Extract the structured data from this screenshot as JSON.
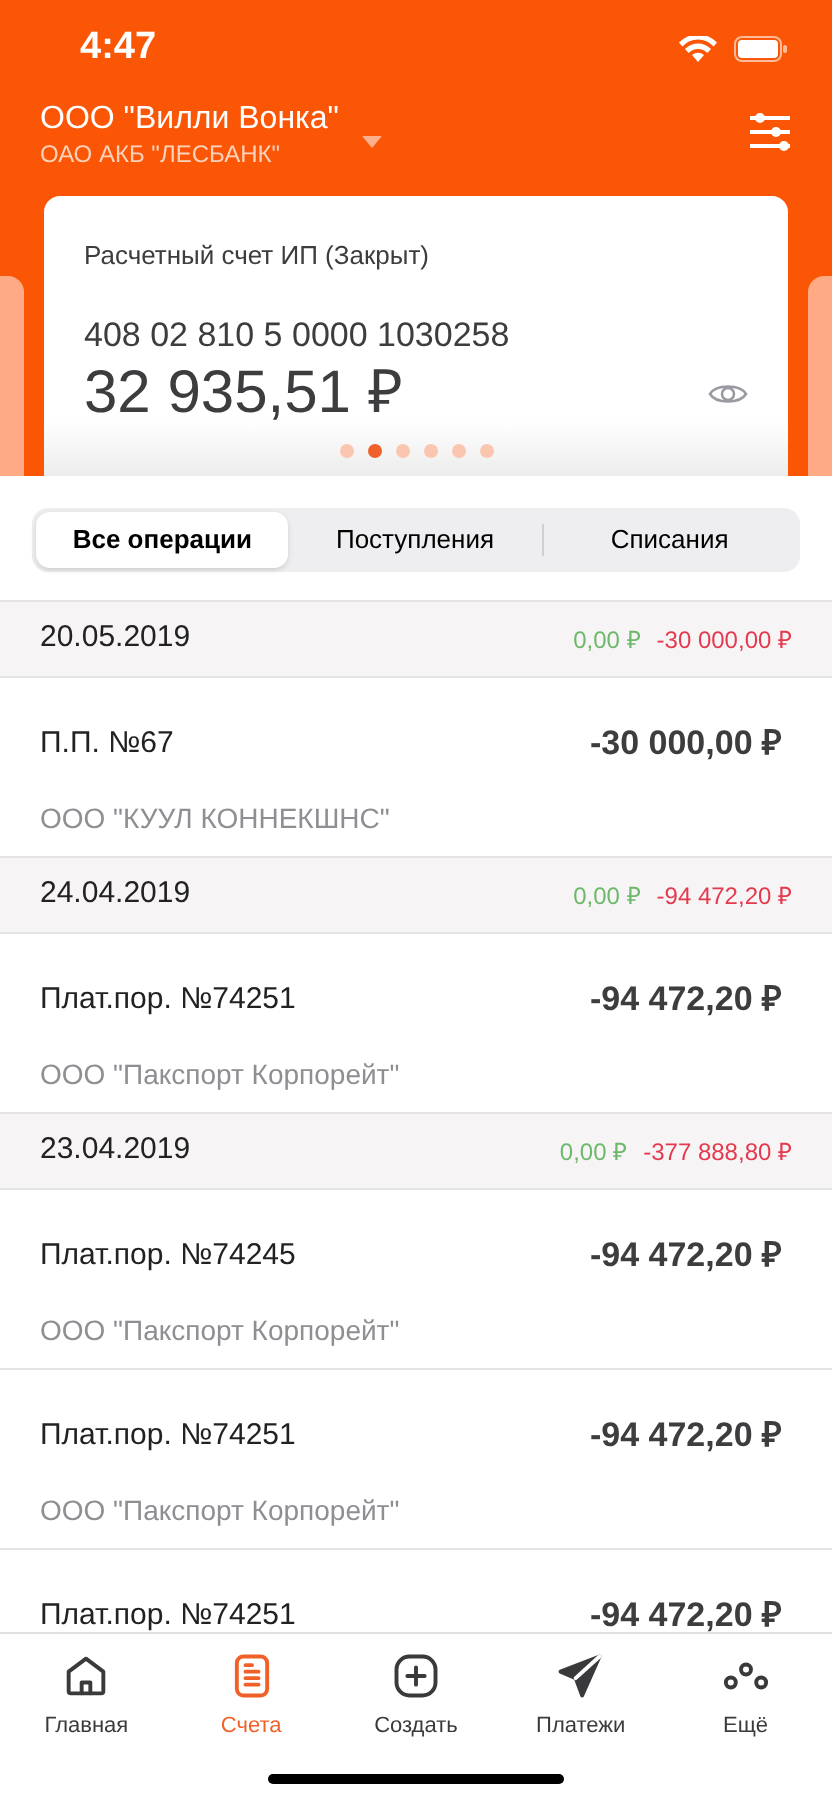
{
  "status_bar": {
    "time": "4:47"
  },
  "header": {
    "company": "ООО \"Вилли Вонка\"",
    "bank": "ОАО АКБ \"ЛЕСБАНК\""
  },
  "account_card": {
    "name": "Расчетный счет ИП (Закрыт)",
    "number": "408 02 810 5 0000 1030258",
    "balance": "32 935,51 ₽"
  },
  "pager": [
    {
      "selected": false
    },
    {
      "selected": true
    },
    {
      "selected": false
    },
    {
      "selected": false
    },
    {
      "selected": false
    },
    {
      "selected": false
    }
  ],
  "tabs": [
    {
      "label": "Все операции",
      "selected": true
    },
    {
      "label": "Поступления",
      "selected": false
    },
    {
      "label": "Списания",
      "selected": false
    }
  ],
  "groups": [
    {
      "date": "20.05.2019",
      "income": "0,00 ₽",
      "outcome": "-30 000,00 ₽",
      "operations": [
        {
          "title": "П.П. №67",
          "amount": "-30 000,00 ₽",
          "counterparty": "ООО \"КУУЛ КОННЕКШНС\""
        }
      ]
    },
    {
      "date": "24.04.2019",
      "income": "0,00 ₽",
      "outcome": "-94 472,20 ₽",
      "operations": [
        {
          "title": "Плат.пор. №74251",
          "amount": "-94 472,20 ₽",
          "counterparty": "ООО \"Пакспорт Корпорейт\""
        }
      ]
    },
    {
      "date": "23.04.2019",
      "income": "0,00 ₽",
      "outcome": "-377 888,80 ₽",
      "operations": [
        {
          "title": "Плат.пор. №74245",
          "amount": "-94 472,20 ₽",
          "counterparty": "ООО \"Пакспорт Корпорейт\""
        },
        {
          "title": "Плат.пор. №74251",
          "amount": "-94 472,20 ₽",
          "counterparty": "ООО \"Пакспорт Корпорейт\""
        },
        {
          "title": "Плат.пор. №74251",
          "amount": "-94 472,20 ₽"
        }
      ]
    }
  ],
  "tab_bar": [
    {
      "label": "Главная",
      "kind": "home",
      "selected": false
    },
    {
      "label": "Счета",
      "kind": "accounts",
      "selected": true
    },
    {
      "label": "Создать",
      "kind": "create",
      "selected": false
    },
    {
      "label": "Платежи",
      "kind": "payments",
      "selected": false
    },
    {
      "label": "Ещё",
      "kind": "more",
      "selected": false
    }
  ]
}
